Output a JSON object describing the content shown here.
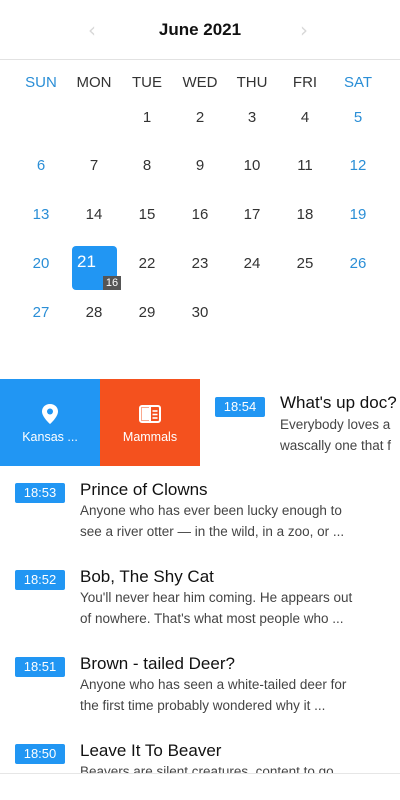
{
  "header": {
    "month_title": "June 2021",
    "prev_icon": "chevron-left",
    "next_icon": "chevron-right"
  },
  "calendar": {
    "weekdays": [
      "SUN",
      "MON",
      "TUE",
      "WED",
      "THU",
      "FRI",
      "SAT"
    ],
    "weeks": [
      [
        "",
        "",
        "1",
        "2",
        "3",
        "4",
        "5"
      ],
      [
        "6",
        "7",
        "8",
        "9",
        "10",
        "11",
        "12"
      ],
      [
        "13",
        "14",
        "15",
        "16",
        "17",
        "18",
        "19"
      ],
      [
        "20",
        "21",
        "22",
        "23",
        "24",
        "25",
        "26"
      ],
      [
        "27",
        "28",
        "29",
        "30",
        "",
        "",
        ""
      ]
    ],
    "selected_day": "21",
    "selected_count": "16",
    "weekend_color": "#2a8ed6",
    "accent_color": "#2196f3"
  },
  "swipe_actions": {
    "location_label": "Kansas ...",
    "location_icon": "map-pin",
    "category_label": "Mammals",
    "category_icon": "book-open",
    "location_color": "#2196f3",
    "category_color": "#f4511e"
  },
  "posts": [
    {
      "time": "18:54",
      "title": "What's up doc?",
      "excerpt": [
        "Everybody loves a",
        "wascally one that f"
      ]
    },
    {
      "time": "18:53",
      "title": "Prince of Clowns",
      "excerpt": [
        "Anyone who has ever been lucky enough to",
        "see a river otter — in the wild, in a zoo, or ..."
      ]
    },
    {
      "time": "18:52",
      "title": "Bob, The Shy Cat",
      "excerpt": [
        "You'll never hear him coming. He appears out",
        "of nowhere. That's what most people who ..."
      ]
    },
    {
      "time": "18:51",
      "title": "Brown - tailed Deer?",
      "excerpt": [
        "Anyone who has seen a white-tailed deer for",
        "the first time probably wondered why it ..."
      ]
    },
    {
      "time": "18:50",
      "title": "Leave It To Beaver",
      "excerpt": [
        "Beavers are silent creatures, content to go",
        ""
      ]
    }
  ]
}
